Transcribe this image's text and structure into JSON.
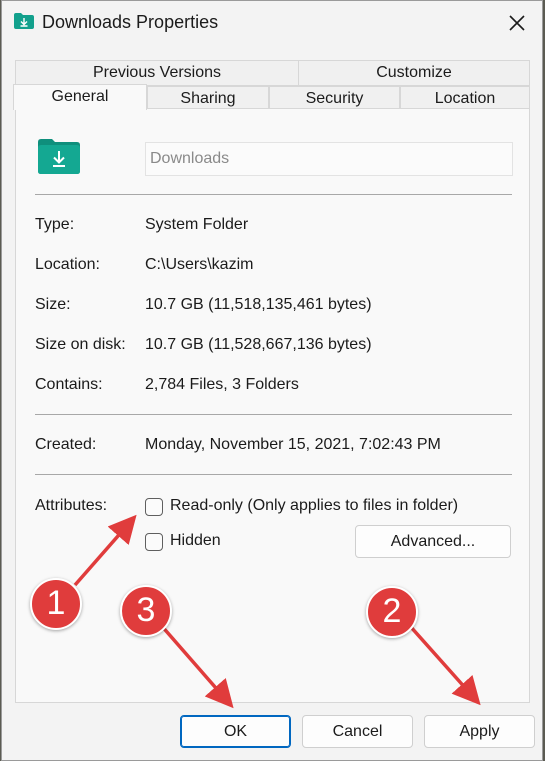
{
  "window": {
    "title": "Downloads Properties",
    "icon": "downloads-folder-icon",
    "close_icon": "close-icon"
  },
  "tabs": {
    "row_back": [
      {
        "label": "Previous Versions",
        "key": "previous-versions"
      },
      {
        "label": "Customize",
        "key": "customize"
      }
    ],
    "row_front": [
      {
        "label": "General",
        "key": "general",
        "active": true
      },
      {
        "label": "Sharing",
        "key": "sharing"
      },
      {
        "label": "Security",
        "key": "security"
      },
      {
        "label": "Location",
        "key": "location"
      }
    ]
  },
  "general": {
    "folder_name": "Downloads",
    "type_label": "Type:",
    "type_value": "System Folder",
    "location_label": "Location:",
    "location_value": "C:\\Users\\kazim",
    "size_label": "Size:",
    "size_value": "10.7 GB (11,518,135,461 bytes)",
    "size_on_disk_label": "Size on disk:",
    "size_on_disk_value": "10.7 GB (11,528,667,136 bytes)",
    "contains_label": "Contains:",
    "contains_value": "2,784 Files, 3 Folders",
    "created_label": "Created:",
    "created_value": "Monday, November 15, 2021, 7:02:43 PM",
    "attributes_label": "Attributes:",
    "readonly_label": "Read-only (Only applies to files in folder)",
    "readonly_checked": false,
    "hidden_label": "Hidden",
    "hidden_checked": false,
    "advanced_label": "Advanced..."
  },
  "footer": {
    "ok_label": "OK",
    "cancel_label": "Cancel",
    "apply_label": "Apply"
  },
  "annotations": {
    "badge_1": "1",
    "badge_2": "2",
    "badge_3": "3",
    "color": "#e03c3c"
  },
  "colors": {
    "accent": "#0067c0",
    "folder": "#0f9d8a"
  }
}
